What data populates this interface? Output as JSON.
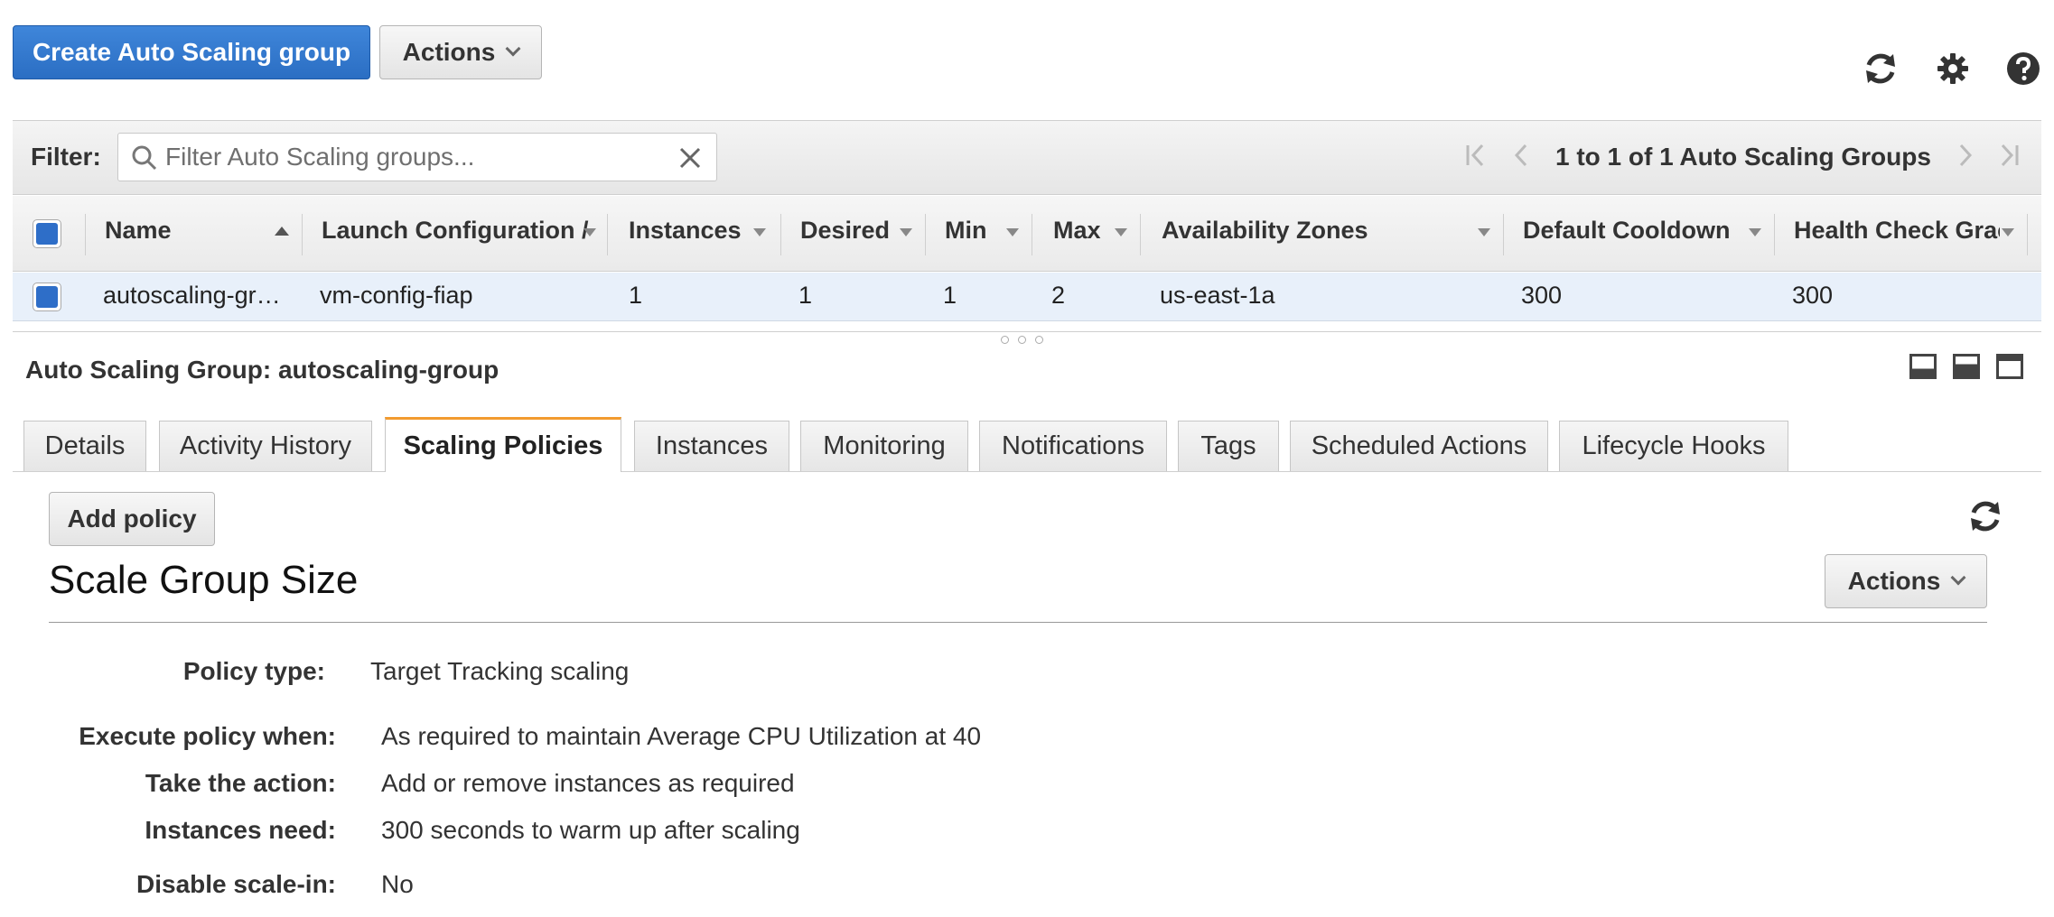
{
  "toolbar": {
    "create_label": "Create Auto Scaling group",
    "actions_label": "Actions",
    "icons": [
      "refresh-icon",
      "gear-icon",
      "help-icon"
    ]
  },
  "filter": {
    "label": "Filter:",
    "placeholder": "Filter Auto Scaling groups...",
    "pager_text": "1 to 1 of 1 Auto Scaling Groups"
  },
  "table": {
    "columns": [
      "Name",
      "Launch Configuration /",
      "Instances",
      "Desired",
      "Min",
      "Max",
      "Availability Zones",
      "Default Cooldown",
      "Health Check Grac"
    ],
    "rows": [
      {
        "name": "autoscaling-gr…",
        "launch_config": "vm-config-fiap",
        "instances": "1",
        "desired": "1",
        "min": "1",
        "max": "2",
        "zones": "us-east-1a",
        "cooldown": "300",
        "health_grace": "300"
      }
    ]
  },
  "detail": {
    "title": "Auto Scaling Group: autoscaling-group",
    "tabs": [
      "Details",
      "Activity History",
      "Scaling Policies",
      "Instances",
      "Monitoring",
      "Notifications",
      "Tags",
      "Scheduled Actions",
      "Lifecycle Hooks"
    ],
    "active_tab": "Scaling Policies",
    "add_policy_label": "Add policy",
    "actions_label": "Actions",
    "policy": {
      "name": "Scale Group Size",
      "policy_type_label": "Policy type:",
      "policy_type_value": "Target Tracking scaling",
      "execute_label": "Execute policy when:",
      "execute_value": "As required to maintain Average CPU Utilization at 40",
      "action_label": "Take the action:",
      "action_value": "Add or remove instances as required",
      "instances_label": "Instances need:",
      "instances_value": "300",
      "instances_suffix": "seconds to warm up after scaling",
      "disable_label": "Disable scale-in:",
      "disable_value": "No"
    }
  },
  "colors": {
    "primary": "#2b6ec3",
    "active_tab_accent": "#f29b2f",
    "selected_row": "#e8f0fa"
  }
}
